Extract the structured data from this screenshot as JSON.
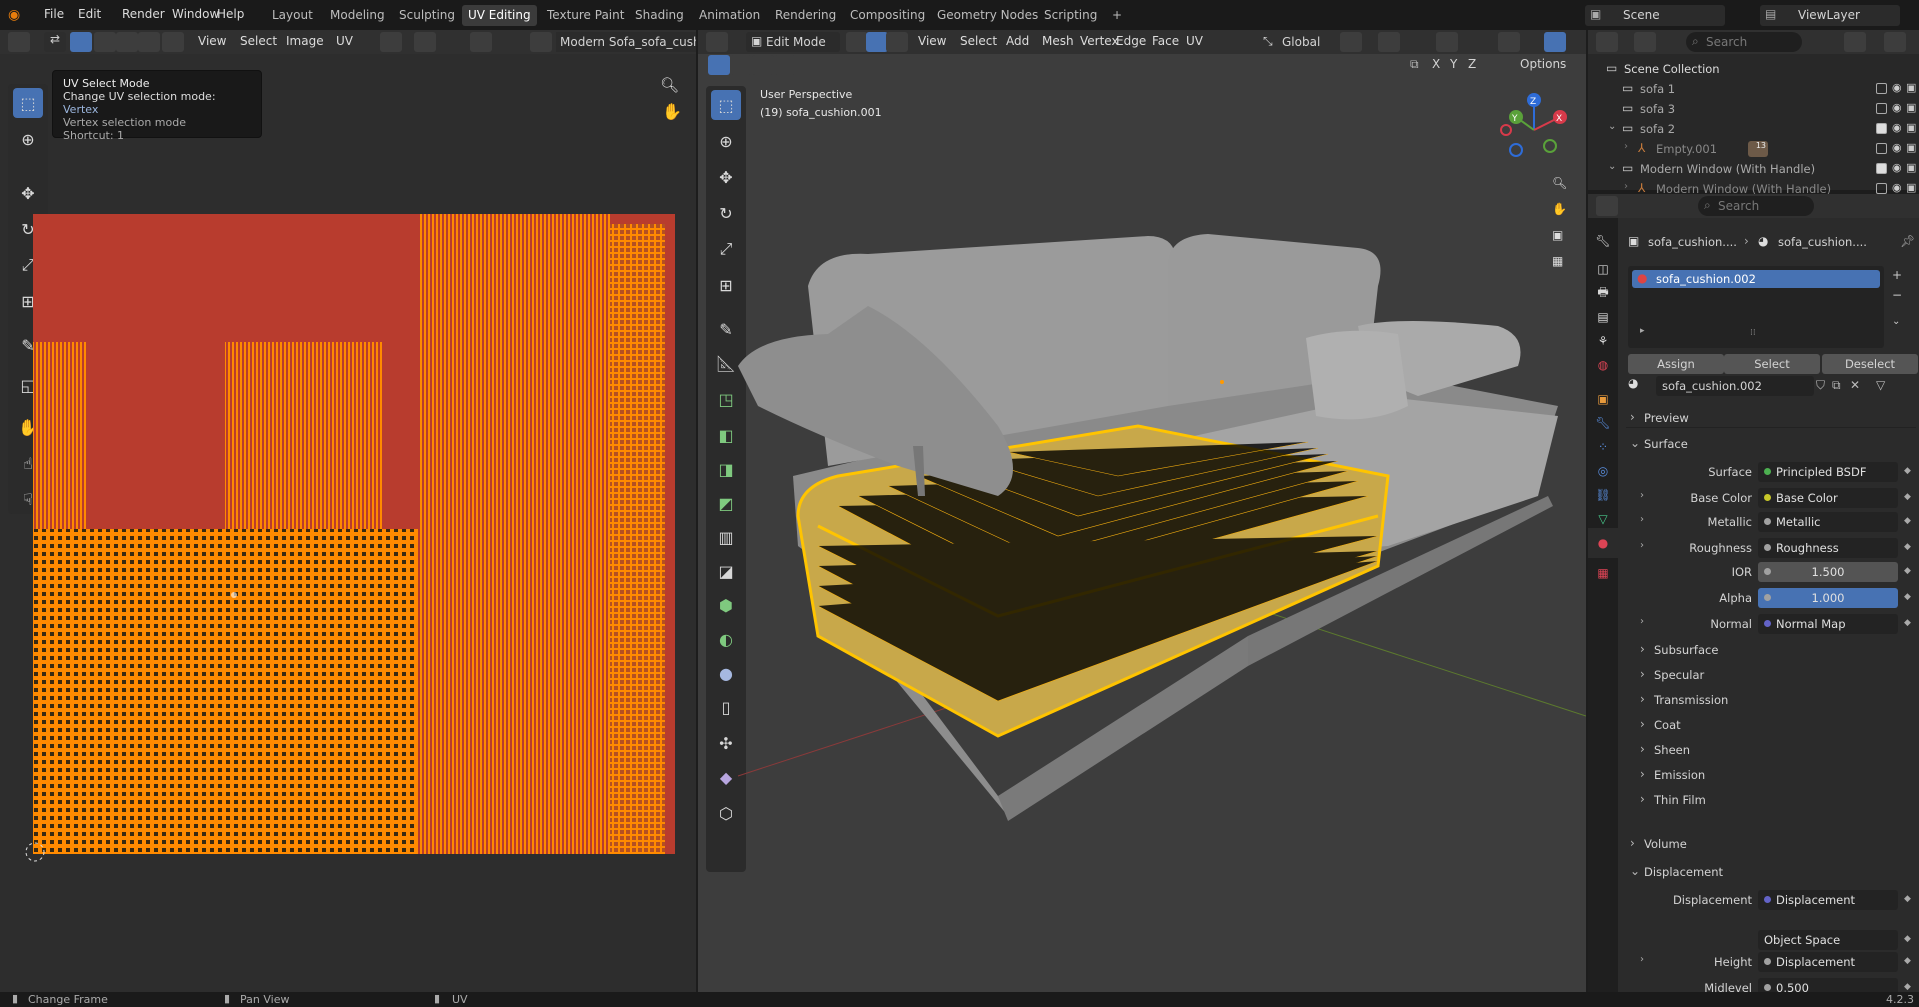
{
  "menus": [
    "File",
    "Edit",
    "Render",
    "Window",
    "Help"
  ],
  "workspaces": [
    "Layout",
    "Modeling",
    "Sculpting",
    "UV Editing",
    "Texture Paint",
    "Shading",
    "Animation",
    "Rendering",
    "Compositing",
    "Geometry Nodes",
    "Scripting"
  ],
  "workspace_add": "+",
  "scene_field": "Scene",
  "viewlayer_field": "ViewLayer",
  "uv_editor": {
    "header_items": [
      "View",
      "Select",
      "Image",
      "UV"
    ],
    "image_name": "Modern Sofa_sofa_cushi",
    "tooltip": {
      "title": "UV Select Mode",
      "line1": "Change UV selection mode:",
      "line1_value": "Vertex",
      "line2": "Vertex selection mode",
      "shortcut": "Shortcut: 1"
    }
  },
  "viewport": {
    "mode": "Edit Mode",
    "header_items": [
      "View",
      "Select",
      "Add",
      "Mesh",
      "Vertex",
      "Edge",
      "Face",
      "UV"
    ],
    "orientation": "Global",
    "options": "Options",
    "xyz": [
      "X",
      "Y",
      "Z"
    ],
    "overlay_title": "User Perspective",
    "overlay_object": "(19) sofa_cushion.001",
    "gizmo_axes": [
      "Z",
      "X",
      "Y"
    ]
  },
  "outliner": {
    "search_placeholder": "Search",
    "items": [
      {
        "label": "Scene Collection",
        "indent": 0
      },
      {
        "label": "sofa 1",
        "indent": 1
      },
      {
        "label": "sofa 3",
        "indent": 1
      },
      {
        "label": "sofa 2",
        "indent": 1
      },
      {
        "label": "Empty.001",
        "indent": 2,
        "badge": "13"
      },
      {
        "label": "Modern Window (With Handle)",
        "indent": 1
      },
      {
        "label": "Modern Window (With Handle)",
        "indent": 2
      }
    ]
  },
  "properties": {
    "search_placeholder": "Search",
    "breadcrumb": [
      "sofa_cushion....",
      "sofa_cushion...."
    ],
    "material_slot": "sofa_cushion.002",
    "slot_buttons": [
      "Assign",
      "Select",
      "Deselect"
    ],
    "material_name": "sofa_cushion.002",
    "sections": {
      "preview": "Preview",
      "surface": "Surface",
      "volume": "Volume",
      "displacement": "Displacement"
    },
    "surface_rows": [
      {
        "label": "Surface",
        "value": "Principled BSDF",
        "dot": "#4caf50"
      },
      {
        "label": "Base Color",
        "value": "Base Color",
        "dot": "#c7c729"
      },
      {
        "label": "Metallic",
        "value": "Metallic",
        "dot": "#a1a1a1"
      },
      {
        "label": "Roughness",
        "value": "Roughness",
        "dot": "#a1a1a1"
      },
      {
        "label": "IOR",
        "value": "1.500",
        "dot": "#a1a1a1"
      },
      {
        "label": "Alpha",
        "value": "1.000",
        "dot": "#a1a1a1"
      },
      {
        "label": "Normal",
        "value": "Normal Map",
        "dot": "#6363c7"
      }
    ],
    "subpanels": [
      "Subsurface",
      "Specular",
      "Transmission",
      "Coat",
      "Sheen",
      "Emission",
      "Thin Film"
    ],
    "displacement_rows": [
      {
        "label": "Displacement",
        "value": "Displacement",
        "dot": "#6363c7"
      },
      {
        "label": "",
        "value": "Object Space",
        "dot": ""
      },
      {
        "label": "Height",
        "value": "Displacement",
        "dot": "#a1a1a1"
      },
      {
        "label": "Midlevel",
        "value": "0.500",
        "dot": "#a1a1a1"
      }
    ]
  },
  "statusbar": {
    "items": [
      "Change Frame",
      "Pan View",
      "UV"
    ],
    "version": "4.2.3"
  },
  "colors": {
    "accent": "#4772b3",
    "uv_orange": "#ff8a00",
    "uv_red": "#b83c2e",
    "selection_yellow": "#ffc400"
  }
}
